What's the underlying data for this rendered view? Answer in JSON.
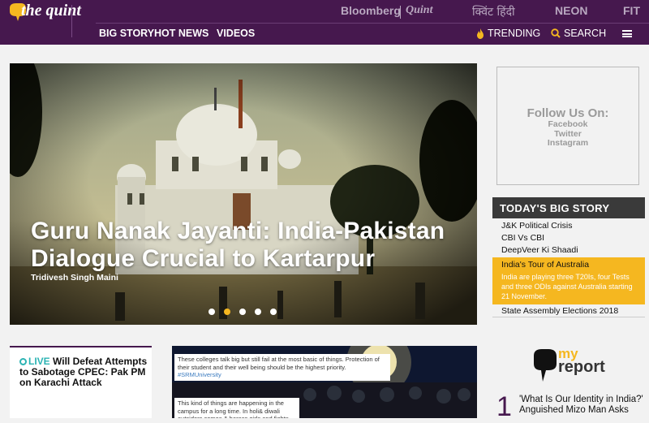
{
  "brand": {
    "logo_text": "the quint"
  },
  "partners": [
    {
      "label": "Bloomberg"
    },
    {
      "label": "Quint"
    },
    {
      "label": "क्विंट हिंदी"
    },
    {
      "label": "NEON"
    },
    {
      "label": "FIT"
    }
  ],
  "nav": {
    "items": [
      {
        "label": "BIG STORY"
      },
      {
        "label": "HOT NEWS"
      },
      {
        "label": "VIDEOS"
      }
    ],
    "trending": "TRENDING",
    "search": "SEARCH"
  },
  "hero": {
    "title": "Guru Nanak Jayanti: India-Pakistan Dialogue Crucial to Kartarpur",
    "author": "Tridivesh Singh Maini",
    "slides": 5,
    "active_slide": 2
  },
  "follow": {
    "title": "Follow Us On:",
    "links": [
      "Facebook",
      "Twitter",
      "Instagram"
    ]
  },
  "today": {
    "heading": "TODAY'S BIG STORY",
    "items": [
      "J&K Political Crisis",
      "CBI Vs CBI",
      "DeepVeer Ki Shaadi"
    ],
    "highlight": {
      "title": "India's Tour of Australia",
      "desc": "India are playing three T20Is, four Tests and three ODIs against Australia starting 21 November."
    },
    "last": "State Assembly Elections 2018"
  },
  "live_card": {
    "badge": "LIVE",
    "title": "Will Defeat Attempts to Sabotage CPEC: Pak PM on Karachi Attack"
  },
  "photo_card": {
    "tweet1": "These colleges talk big but still fail at the most basic of things. Protection of their student and their well being should be the highest priority.",
    "hashtag": "#SRMUniversity",
    "tweet2": "This kind of things are happening in the campus for a long time. In holi& diwali outsiders comes & harass girls and fights."
  },
  "myreport": {
    "my": "my",
    "report": "report",
    "rank": "1",
    "headline": "'What Is Our Identity in India?' Anguished Mizo Man Asks"
  },
  "colors": {
    "header": "#46184e",
    "accent": "#f5b720",
    "live": "#2bb3b3"
  }
}
